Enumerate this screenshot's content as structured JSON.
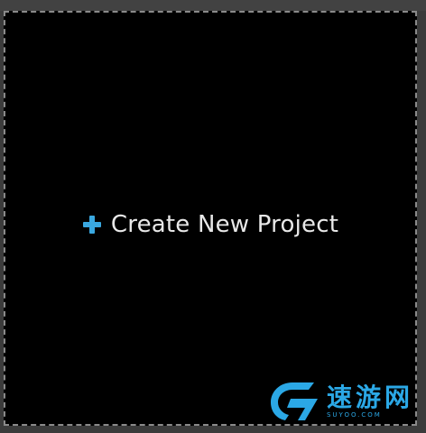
{
  "canvas": {
    "action_label": "Create New Project",
    "plus_icon": "plus-icon",
    "accent_color": "#3aa8e0"
  },
  "watermark": {
    "logo_icon": "g-logo-icon",
    "text": "速游网",
    "subtext": "SUYOO.COM",
    "color": "#2ba8e6"
  }
}
